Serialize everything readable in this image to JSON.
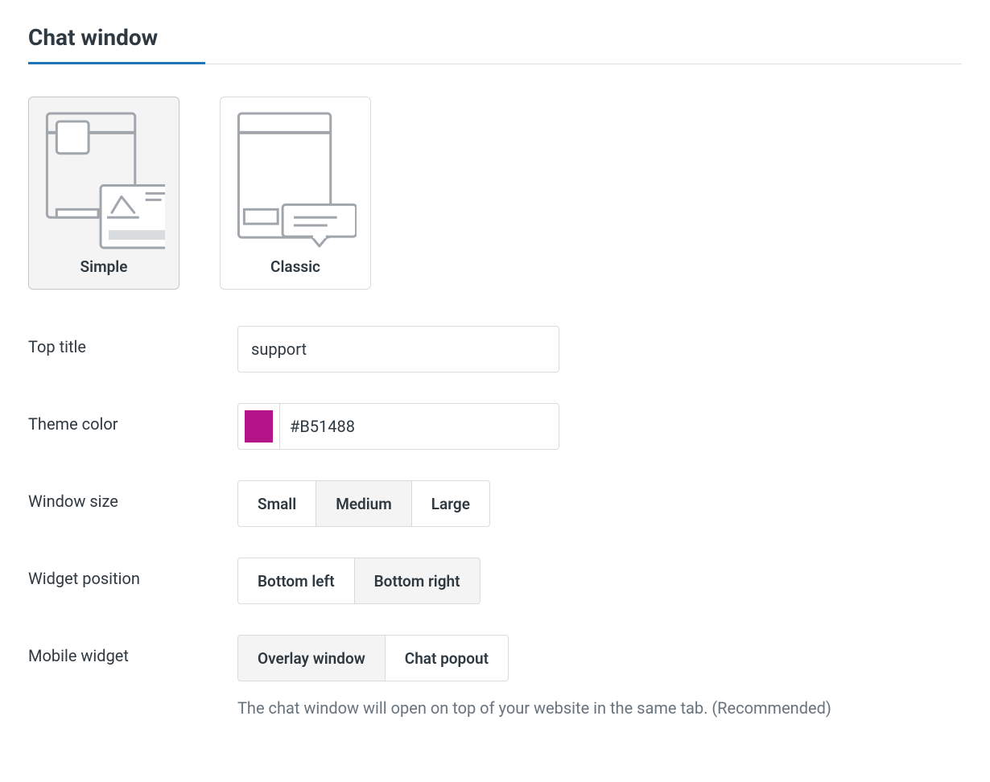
{
  "section": {
    "title": "Chat window"
  },
  "designs": {
    "simple": "Simple",
    "classic": "Classic"
  },
  "fields": {
    "top_title": {
      "label": "Top title",
      "value": "support"
    },
    "theme_color": {
      "label": "Theme color",
      "value": "#B51488"
    },
    "window_size": {
      "label": "Window size",
      "options": {
        "small": "Small",
        "medium": "Medium",
        "large": "Large"
      }
    },
    "widget_position": {
      "label": "Widget position",
      "options": {
        "bottom_left": "Bottom left",
        "bottom_right": "Bottom right"
      }
    },
    "mobile_widget": {
      "label": "Mobile widget",
      "options": {
        "overlay": "Overlay window",
        "popout": "Chat popout"
      },
      "description": "The chat window will open on top of your website in the same tab. (Recommended)"
    }
  }
}
